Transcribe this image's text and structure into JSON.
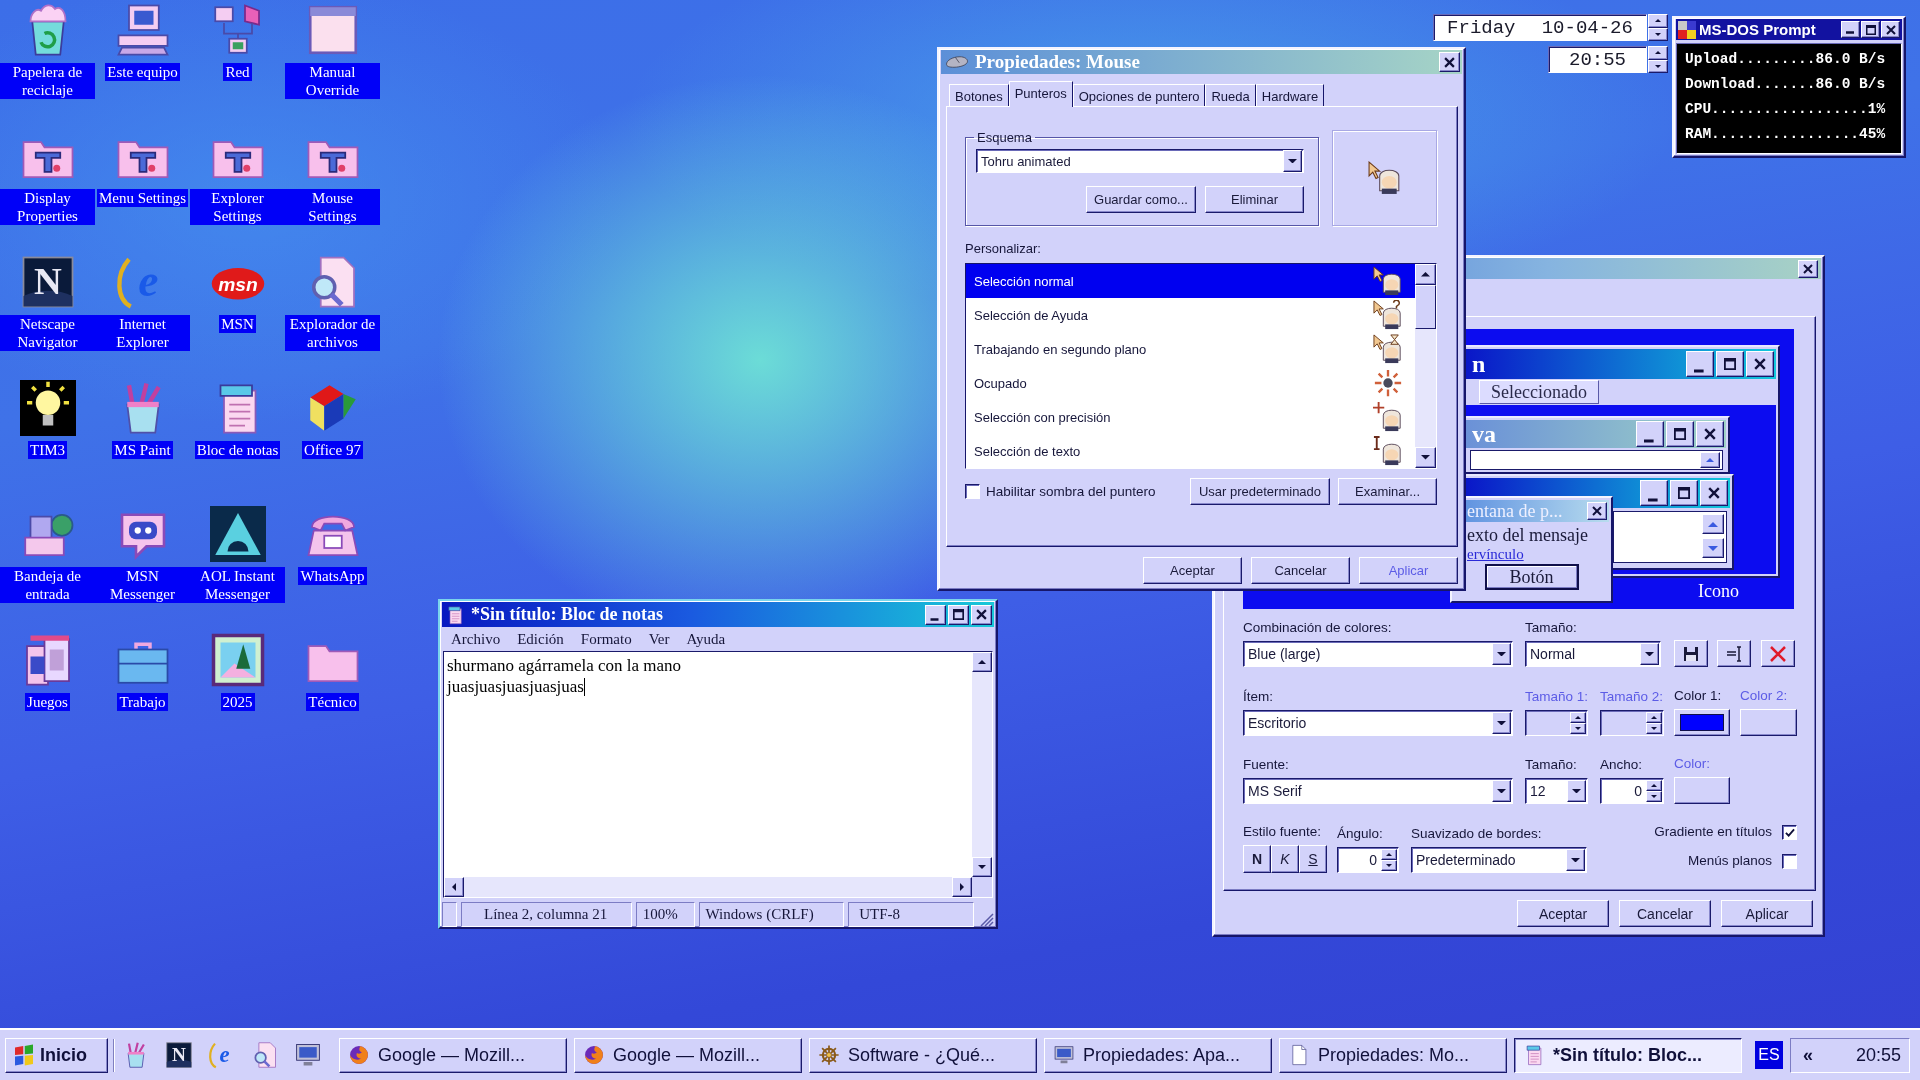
{
  "desktop_icons": [
    {
      "label": "Papelera de reciclaje"
    },
    {
      "label": "Este equipo"
    },
    {
      "label": "Red"
    },
    {
      "label": "Manual Override"
    },
    {
      "label": "Display Properties"
    },
    {
      "label": "Menu Settings"
    },
    {
      "label": "Explorer Settings"
    },
    {
      "label": "Mouse Settings"
    },
    {
      "label": "Netscape Navigator",
      "logo": "N"
    },
    {
      "label": "Internet Explorer",
      "logo": "e"
    },
    {
      "label": "MSN",
      "logo": "msn"
    },
    {
      "label": "Explorador de archivos"
    },
    {
      "label": "TIM3"
    },
    {
      "label": "MS Paint"
    },
    {
      "label": "Bloc de notas"
    },
    {
      "label": "Office 97"
    },
    {
      "label": "Bandeja de entrada"
    },
    {
      "label": "MSN Messenger"
    },
    {
      "label": "AOL Instant Messenger"
    },
    {
      "label": "WhatsApp"
    },
    {
      "label": "Juegos"
    },
    {
      "label": "Trabajo"
    },
    {
      "label": "2025"
    },
    {
      "label": "Técnico"
    }
  ],
  "date_widget": {
    "day": "Friday",
    "date": "10-04-26",
    "time": "20:55"
  },
  "dos_window": {
    "title": "MS-DOS Prompt",
    "lines": [
      "Upload.........86.0 B/s",
      "Download.......86.0 B/s",
      "CPU..................1%",
      "RAM.................45%"
    ]
  },
  "mouse_properties": {
    "title": "Propiedades: Mouse",
    "tabs": [
      {
        "label": "Botones",
        "selected": false
      },
      {
        "label": "Punteros",
        "selected": true
      },
      {
        "label": "Opciones de puntero",
        "selected": false
      },
      {
        "label": "Rueda",
        "selected": false
      },
      {
        "label": "Hardware",
        "selected": false
      }
    ],
    "scheme": {
      "legend": "Esquema",
      "value": "Tohru animated",
      "buttons": [
        "Guardar como...",
        "Eliminar"
      ]
    },
    "customize_label": "Personalizar:",
    "pointers": [
      {
        "label": "Selección normal",
        "selected": true
      },
      {
        "label": "Selección de Ayuda",
        "selected": false
      },
      {
        "label": "Trabajando en segundo plano",
        "selected": false
      },
      {
        "label": "Ocupado",
        "selected": false
      },
      {
        "label": "Selección con precisión",
        "selected": false
      },
      {
        "label": "Selección de texto",
        "selected": false
      }
    ],
    "shadow_checkbox": {
      "label": "Habilitar sombra del puntero",
      "checked": false
    },
    "list_buttons": [
      "Usar predeterminado",
      "Examinar..."
    ],
    "buttons": [
      {
        "label": "Aceptar",
        "disabled": false
      },
      {
        "label": "Cancelar",
        "disabled": false
      },
      {
        "label": "Aplicar",
        "disabled": true
      }
    ]
  },
  "display_properties": {
    "preview": {
      "window_1_title": "n",
      "menu_item": "Seleccionado",
      "window_2_title": "va",
      "message_box": {
        "title": "entana de p...",
        "text": "exto del mensaje",
        "link": "ervínculo",
        "button": "Botón"
      },
      "icon_label": "Icono"
    },
    "form": {
      "color_scheme": {
        "label": "Combinación de colores:",
        "value": "Blue (large)"
      },
      "scheme_size": {
        "label": "Tamaño:",
        "value": "Normal"
      },
      "item": {
        "label": "Ítem:",
        "value": "Escritorio"
      },
      "item_size_1": {
        "label": "Tamaño 1:",
        "disabled": true
      },
      "item_size_2": {
        "label": "Tamaño 2:",
        "disabled": true
      },
      "color_1": {
        "label": "Color 1:",
        "disabled": false,
        "color": "#0000ff"
      },
      "color_2": {
        "label": "Color 2:",
        "disabled": true
      },
      "font": {
        "label": "Fuente:",
        "value": "MS Serif"
      },
      "font_size": {
        "label": "Tamaño:",
        "value": "12"
      },
      "font_width": {
        "label": "Ancho:",
        "value": "0"
      },
      "font_color": {
        "label": "Color:",
        "disabled": true
      },
      "font_style": {
        "label": "Estilo fuente:",
        "buttons": [
          "N",
          "K",
          "S"
        ]
      },
      "angle": {
        "label": "Ángulo:",
        "value": "0"
      },
      "smoothing": {
        "label": "Suavizado de bordes:",
        "value": "Predeterminado"
      },
      "gradient_titles": {
        "label": "Gradiente en títulos",
        "checked": true
      },
      "flat_menus": {
        "label": "Menús planos",
        "checked": false
      }
    },
    "buttons": [
      {
        "label": "Aceptar",
        "disabled": false
      },
      {
        "label": "Cancelar",
        "disabled": false
      },
      {
        "label": "Aplicar",
        "disabled": false
      }
    ]
  },
  "notepad": {
    "title": "*Sin título: Bloc de notas",
    "menu": [
      "Archivo",
      "Edición",
      "Formato",
      "Ver",
      "Ayuda"
    ],
    "lines": [
      "shurmano agárramela con la mano",
      "juasjuasjuasjuasjuas"
    ],
    "status": [
      "Línea 2, columna 21",
      "100%",
      "Windows (CRLF)",
      "UTF-8"
    ]
  },
  "taskbar": {
    "start": "Inicio",
    "quick_launch": [
      {
        "kind": "paint"
      },
      {
        "kind": "nlogo",
        "logo": "N"
      },
      {
        "kind": "elogo",
        "logo": "e"
      },
      {
        "kind": "finder"
      },
      {
        "kind": "display"
      }
    ],
    "tasks": [
      {
        "label": "Google — Mozill...",
        "selected": false
      },
      {
        "label": "Google — Mozill...",
        "selected": false
      },
      {
        "label": "Software - ¿Qué...",
        "selected": false
      },
      {
        "label": "Propiedades: Apa...",
        "selected": false
      },
      {
        "label": "Propiedades: Mo...",
        "selected": false
      },
      {
        "label": "*Sin título: Bloc...",
        "selected": true
      }
    ],
    "language": "ES",
    "tray_toggle": "«",
    "clock": "20:55"
  }
}
